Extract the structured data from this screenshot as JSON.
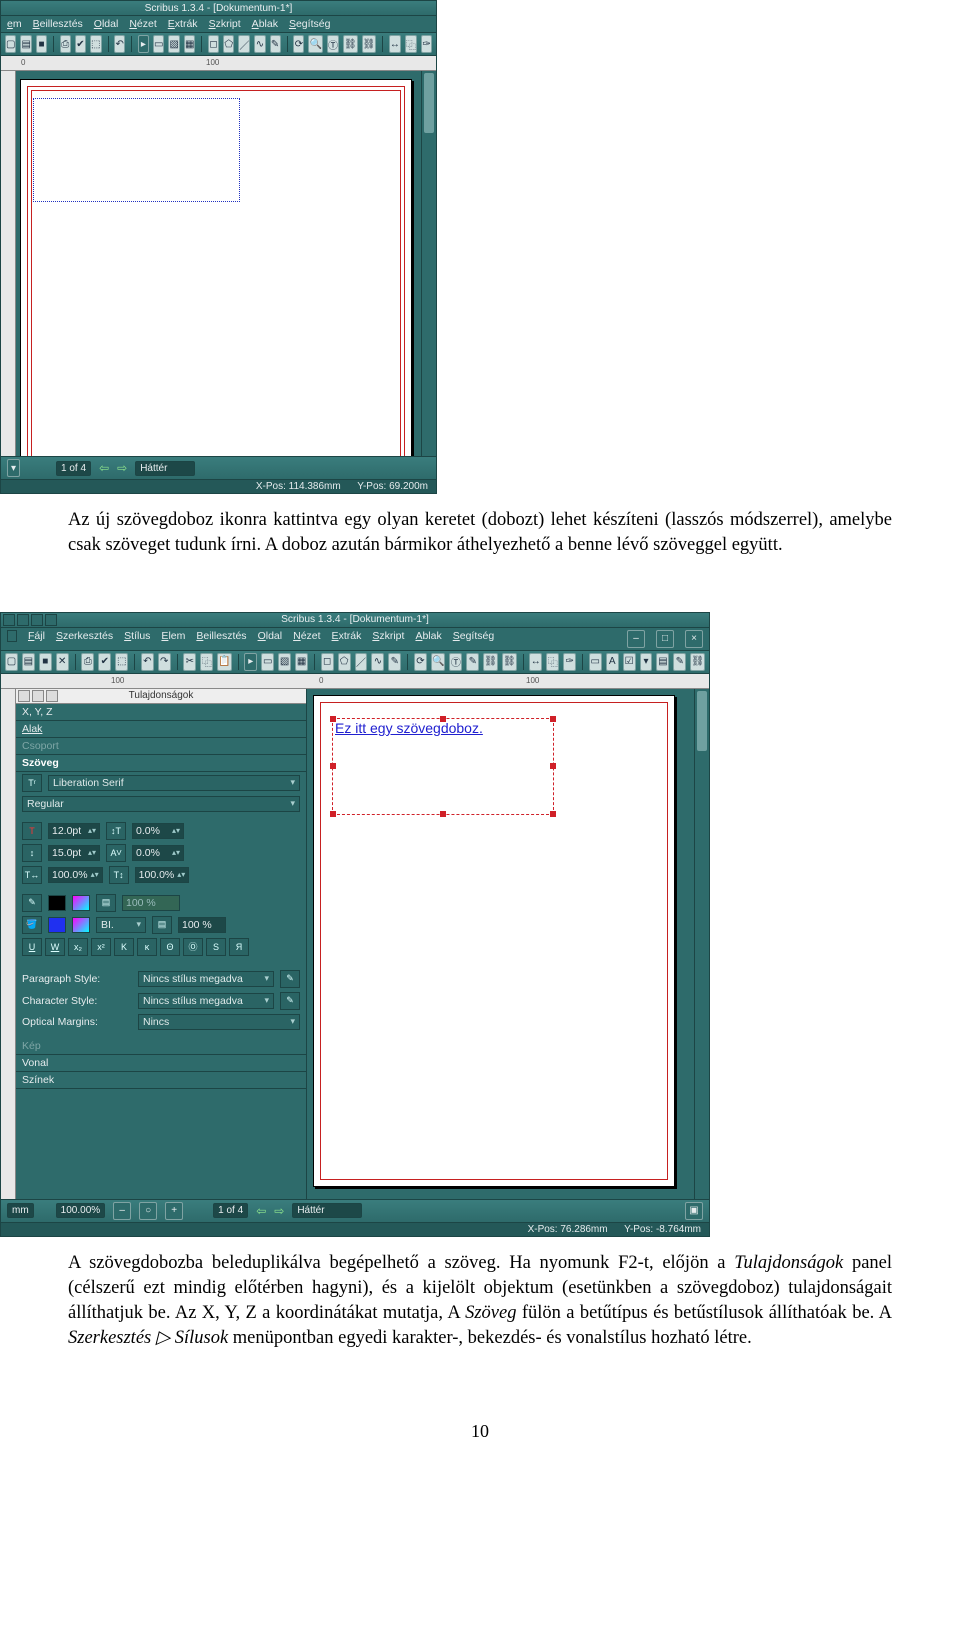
{
  "page_number": "10",
  "para1": "Az új szövegdoboz ikonra kattintva egy olyan keretet (dobozt) lehet készíteni (lasszós módszerrel), amelybe csak szöveget tudunk írni. A doboz azután bármikor áthelyezhető a benne lévő szöveggel együtt.",
  "para2_a": "A szövegdobozba beleduplikálva begépelhető a szöveg. Ha nyomunk F2-t, előjön a ",
  "para2_it1": "Tulajdonságok",
  "para2_b": " panel (célszerű ezt mindig előtérben hagyni), és a kijelölt objektum (esetünkben a szövegdoboz) tulajdonságait állíthatjuk be. Az X, Y, Z a koordinátákat mutatja, A ",
  "para2_it2": "Szöveg",
  "para2_c": " fülön a betűtípus és betűstílusok állíthatóak be. A ",
  "para2_it3": "Szerkesztés ▷ Sílusok",
  "para2_d": " menüpontban egyedi karakter-, bekezdés- és vonalstílus hozható létre.",
  "shot1": {
    "title": "Scribus 1.3.4 - [Dokumentum-1*]",
    "menu": [
      "em",
      "Beillesztés",
      "Oldal",
      "Nézet",
      "Extrák",
      "Szkript",
      "Ablak",
      "Segítség"
    ],
    "ruler_0": "0",
    "ruler_100": "100",
    "status_pages": "1 of 4",
    "status_layer": "Háttér",
    "pos_x": "X-Pos: 114.386mm",
    "pos_y": "Y-Pos: 69.200m"
  },
  "shot2": {
    "title": "Scribus 1.3.4 - [Dokumentum-1*]",
    "menu": [
      "Fájl",
      "Szerkesztés",
      "Stílus",
      "Elem",
      "Beillesztés",
      "Oldal",
      "Nézet",
      "Extrák",
      "Szkript",
      "Ablak",
      "Segítség"
    ],
    "ruler_m100": "100",
    "ruler_0": "0",
    "ruler_100": "100",
    "textframe_content": "Ez itt egy szövegdoboz.",
    "statusbar_unit": "mm",
    "statusbar_zoom": "100.00%",
    "statusbar_pages": "1 of 4",
    "statusbar_layer": "Háttér",
    "pos_x": "X-Pos: 76.286mm",
    "pos_y": "Y-Pos: -8.764mm",
    "prop": {
      "panel_title": "Tulajdonságok",
      "sec_xyz": "X, Y, Z",
      "sec_alak": "Alak",
      "sec_csoport": "Csoport",
      "sec_szoveg": "Szöveg",
      "font_family": "Liberation Serif",
      "font_style": "Regular",
      "size_pt": "12.0pt",
      "size_pt2": "0.0%",
      "leading": "15.0pt",
      "leading2": "0.0%",
      "width_pct": "100.0%",
      "height_pct": "100.0%",
      "opacity1": "100 %",
      "shade_label": "BI.",
      "shade_val": "100 %",
      "para_style_label": "Paragraph Style:",
      "para_style_val": "Nincs stílus megadva",
      "char_style_label": "Character Style:",
      "char_style_val": "Nincs stílus megadva",
      "optmarg_label": "Optical Margins:",
      "optmarg_val": "Nincs",
      "sec_kep": "Kép",
      "sec_vonal": "Vonal",
      "sec_szinek": "Színek"
    }
  }
}
